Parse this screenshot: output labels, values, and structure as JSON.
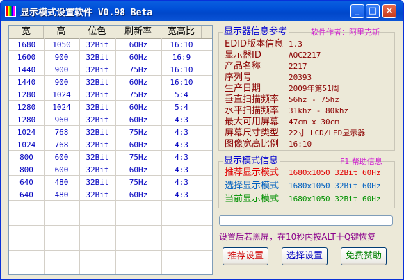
{
  "window": {
    "title": "显示模式设置软件 V0.98 Beta",
    "controls": {
      "minimize": "_",
      "maximize": "□",
      "close": "✕"
    }
  },
  "mode_table": {
    "columns": [
      "宽",
      "高",
      "位色",
      "刷新率",
      "宽高比"
    ],
    "rows": [
      [
        "1680",
        "1050",
        "32Bit",
        "60Hz",
        "16:10"
      ],
      [
        "1600",
        "900",
        "32Bit",
        "60Hz",
        "16:9"
      ],
      [
        "1440",
        "900",
        "32Bit",
        "75Hz",
        "16:10"
      ],
      [
        "1440",
        "900",
        "32Bit",
        "60Hz",
        "16:10"
      ],
      [
        "1280",
        "1024",
        "32Bit",
        "75Hz",
        "5:4"
      ],
      [
        "1280",
        "1024",
        "32Bit",
        "60Hz",
        "5:4"
      ],
      [
        "1280",
        "960",
        "32Bit",
        "60Hz",
        "4:3"
      ],
      [
        "1024",
        "768",
        "32Bit",
        "75Hz",
        "4:3"
      ],
      [
        "1024",
        "768",
        "32Bit",
        "60Hz",
        "4:3"
      ],
      [
        "800",
        "600",
        "32Bit",
        "75Hz",
        "4:3"
      ],
      [
        "800",
        "600",
        "32Bit",
        "60Hz",
        "4:3"
      ],
      [
        "640",
        "480",
        "32Bit",
        "75Hz",
        "4:3"
      ],
      [
        "640",
        "480",
        "32Bit",
        "60Hz",
        "4:3"
      ]
    ]
  },
  "monitor_info": {
    "title": "显示器信息参考",
    "author": "软件作者：阿里克斯",
    "fields": [
      {
        "label": "EDID版本信息",
        "value": "1.3"
      },
      {
        "label": "显示器ID",
        "value": "AOC2217"
      },
      {
        "label": "产品名称",
        "value": "2217"
      },
      {
        "label": "序列号",
        "value": "20393"
      },
      {
        "label": "生产日期",
        "value": "2009年第51周"
      },
      {
        "label": "垂直扫描频率",
        "value": "56hz - 75hz"
      },
      {
        "label": "水平扫描频率",
        "value": "31khz - 80khz"
      },
      {
        "label": "最大可用屏幕",
        "value": "47cm x 30cm"
      },
      {
        "label": "屏幕尺寸类型",
        "value": "22寸 LCD/LED显示器"
      },
      {
        "label": "图像宽高比例",
        "value": "16:10"
      }
    ]
  },
  "mode_info": {
    "title": "显示模式信息",
    "help": "F1 帮助信息",
    "rows": [
      {
        "label": "推荐显示模式",
        "value": "1680x1050 32Bit 60Hz",
        "color": "#e00000"
      },
      {
        "label": "选择显示模式",
        "value": "1680x1050 32Bit 60Hz",
        "color": "#0060c0"
      },
      {
        "label": "当前显示模式",
        "value": "1680x1050 32Bit 60Hz",
        "color": "#009000"
      }
    ]
  },
  "progress": {
    "value": 0
  },
  "hint": "设置后若黑屏，在10秒内按ALT十Q键恢复",
  "buttons": {
    "recommend": {
      "label": "推荐设置",
      "color": "#d00000"
    },
    "apply": {
      "label": "选择设置",
      "color": "#0000c0"
    },
    "donate": {
      "label": "免费赞助",
      "color": "#008000"
    }
  }
}
